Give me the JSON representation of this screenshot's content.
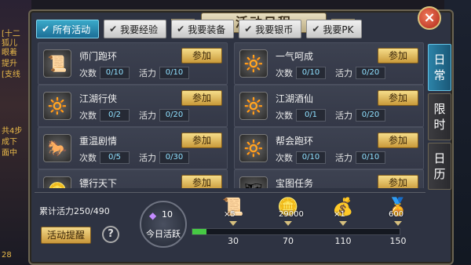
{
  "background_left_text": [
    "[十二",
    "狐儿",
    "眼着",
    "提升",
    "[支线",
    "共4步",
    "成下",
    "面中",
    "28"
  ],
  "title": "活动日程",
  "close_label": "×",
  "tabs": [
    {
      "label": "所有活动",
      "active": true
    },
    {
      "label": "我要经验",
      "active": false
    },
    {
      "label": "我要装备",
      "active": false
    },
    {
      "label": "我要银币",
      "active": false
    },
    {
      "label": "我要PK",
      "active": false
    }
  ],
  "side_tabs": [
    {
      "chars": [
        "日",
        "常"
      ],
      "active": true
    },
    {
      "chars": [
        "限",
        "时"
      ],
      "active": false
    },
    {
      "chars": [
        "日",
        "历"
      ],
      "active": false
    }
  ],
  "activities": [
    {
      "name": "师门跑环",
      "count": "0/10",
      "vitality": "0/10",
      "icon": "quest-scroll-icon",
      "glyph": "📜"
    },
    {
      "name": "一气呵成",
      "count": "0/10",
      "vitality": "0/20",
      "icon": "golden-orb-icon",
      "glyph": "🔆"
    },
    {
      "name": "江湖行侠",
      "count": "0/2",
      "vitality": "0/20",
      "icon": "golden-orb-icon",
      "glyph": "🔆"
    },
    {
      "name": "江湖酒仙",
      "count": "0/1",
      "vitality": "0/20",
      "icon": "golden-orb-icon",
      "glyph": "🔆"
    },
    {
      "name": "重温剧情",
      "count": "0/5",
      "vitality": "0/30",
      "icon": "horse-icon",
      "glyph": "🐎"
    },
    {
      "name": "帮会跑环",
      "count": "0/10",
      "vitality": "0/10",
      "icon": "golden-orb-icon",
      "glyph": "🔆"
    },
    {
      "name": "镖行天下",
      "count": "",
      "vitality": "",
      "icon": "silver-ingot-icon",
      "glyph": "🪙"
    },
    {
      "name": "宝图任务",
      "count": "",
      "vitality": "",
      "icon": "treasure-map-icon",
      "glyph": "🗺"
    }
  ],
  "labels": {
    "count": "次数",
    "vitality": "活力",
    "join": "参加"
  },
  "total_vitality": "累计活力250/490",
  "remind_button": "活动提醒",
  "help_label": "?",
  "today": {
    "gem_count": "10",
    "label": "今日活跃"
  },
  "progress_fraction": 0.07,
  "rewards": [
    {
      "icon": "scroll-reward-icon",
      "glyph": "📜",
      "count": "×5",
      "milestone": "30"
    },
    {
      "icon": "silver-coins-icon",
      "glyph": "🪙",
      "count": "29000",
      "milestone": "70"
    },
    {
      "icon": "money-bag-icon",
      "glyph": "💰",
      "count": "×1",
      "milestone": "110"
    },
    {
      "icon": "gold-ingots-icon",
      "glyph": "🏅",
      "count": "600",
      "milestone": "150"
    }
  ]
}
